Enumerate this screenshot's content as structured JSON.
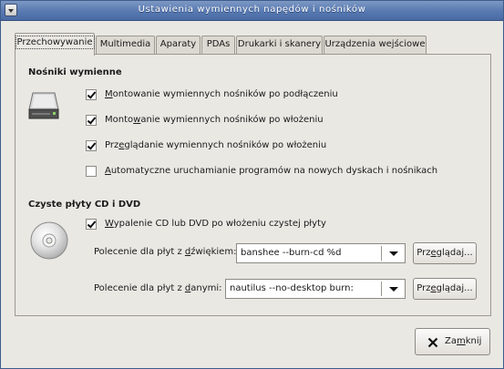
{
  "window": {
    "title": "Ustawienia wymiennych napędów i nośników"
  },
  "tabs": [
    {
      "label": "Przechowywanie"
    },
    {
      "label": "Multimedia"
    },
    {
      "label": "Aparaty"
    },
    {
      "label": "PDAs"
    },
    {
      "label": "Drukarki i skanery"
    },
    {
      "label": "Urządzenia wejściowe"
    }
  ],
  "removable": {
    "title": "Nośniki wymienne",
    "icon": "drive-icon",
    "options": [
      {
        "pre": "",
        "u": "M",
        "post": "ontowanie wymiennych nośników po podłączeniu",
        "checked": true
      },
      {
        "pre": "Monto",
        "u": "w",
        "post": "anie wymiennych nośników po włożeniu",
        "checked": true
      },
      {
        "pre": "Prz",
        "u": "e",
        "post": "glądanie wymiennych nośników po włożeniu",
        "checked": true
      },
      {
        "pre": "",
        "u": "A",
        "post": "utomatyczne uruchamianie programów na nowych dyskach i nośnikach",
        "checked": false
      }
    ]
  },
  "blank_cd": {
    "title": "Czyste płyty CD i DVD",
    "icon": "cd-icon",
    "option": {
      "pre": "",
      "u": "W",
      "post": "ypalenie CD lub DVD po włożeniu czystej płyty",
      "checked": true
    },
    "audio": {
      "label_pre": "Polecenie dla płyt z ",
      "label_u": "d",
      "label_post": "źwiękiem:",
      "value": "banshee --burn-cd %d",
      "browse_pre": "Prz",
      "browse_u": "e",
      "browse_post": "glądaj..."
    },
    "data": {
      "label_pre": "Polecenie dla płyt z ",
      "label_u": "d",
      "label_post": "anymi:",
      "value": "nautilus --no-desktop burn:",
      "browse_pre": "Prz",
      "browse_u": "e",
      "browse_post": "glądaj..."
    }
  },
  "close_button": {
    "pre": "Za",
    "u": "m",
    "post": "knij",
    "icon": "close-icon"
  }
}
